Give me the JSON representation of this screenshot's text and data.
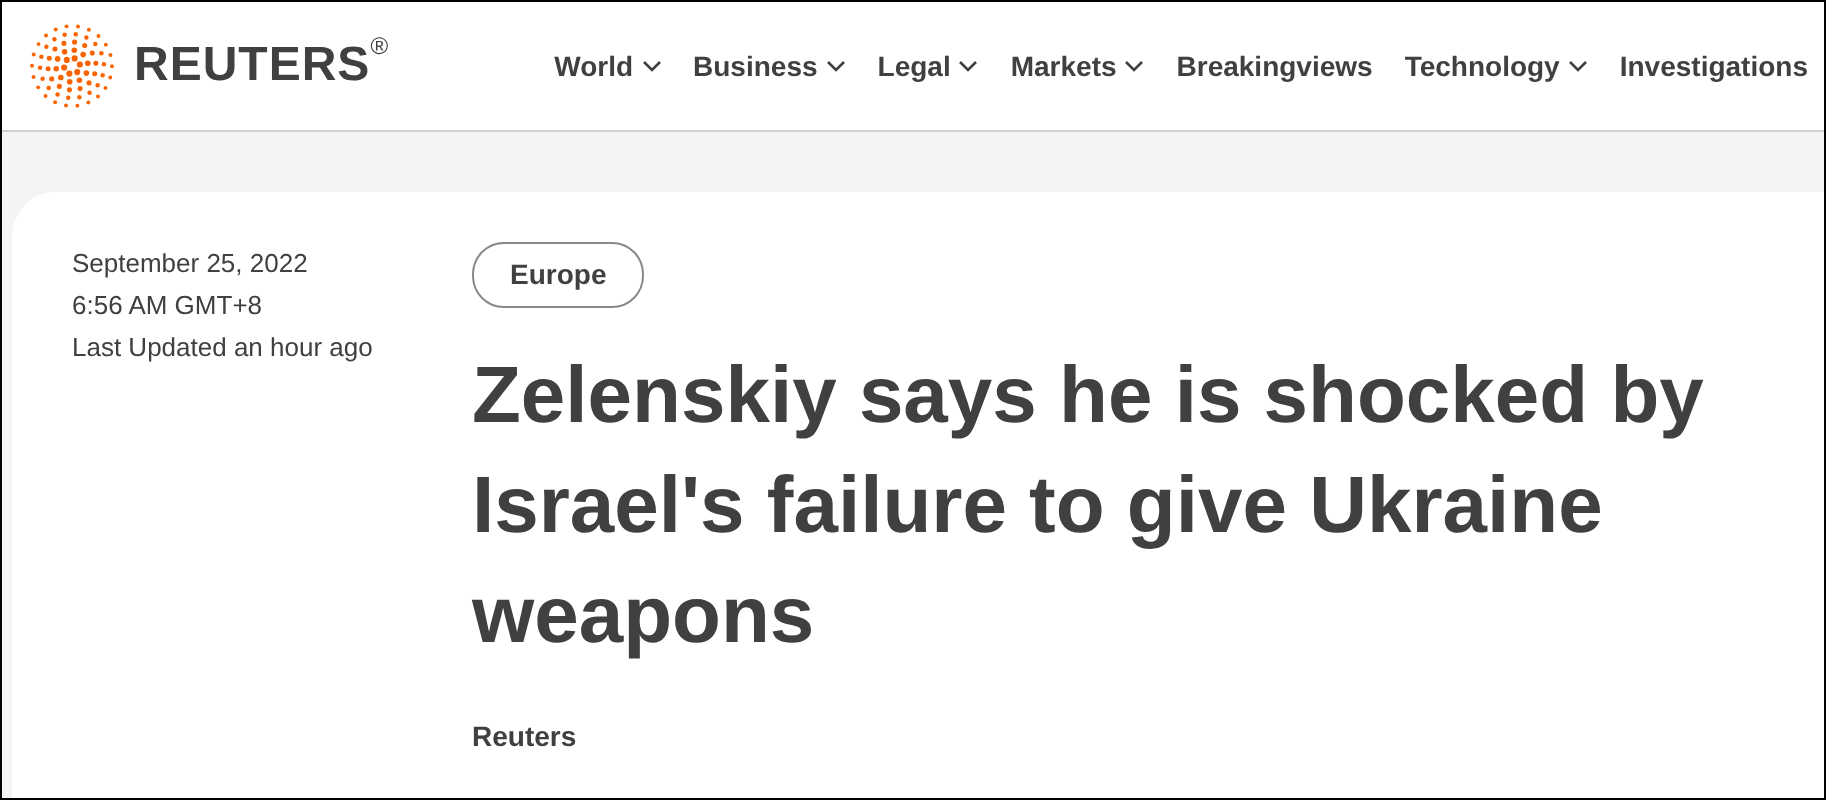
{
  "header": {
    "logo_text": "REUTERS$^{®}$",
    "nav": [
      {
        "label": "World",
        "dropdown": true
      },
      {
        "label": "Business",
        "dropdown": true
      },
      {
        "label": "Legal",
        "dropdown": true
      },
      {
        "label": "Markets",
        "dropdown": true
      },
      {
        "label": "Breakingviews",
        "dropdown": false
      },
      {
        "label": "Technology",
        "dropdown": true
      },
      {
        "label": "Investigations",
        "dropdown": false
      }
    ]
  },
  "article": {
    "date": "September 25, 2022",
    "time": "6:56 AM GMT+8",
    "updated": "Last Updated an hour ago",
    "tag": "Europe",
    "headline": "Zelenskiy says he is shocked by Israel's failure to give Ukraine weapons",
    "byline": "Reuters"
  }
}
